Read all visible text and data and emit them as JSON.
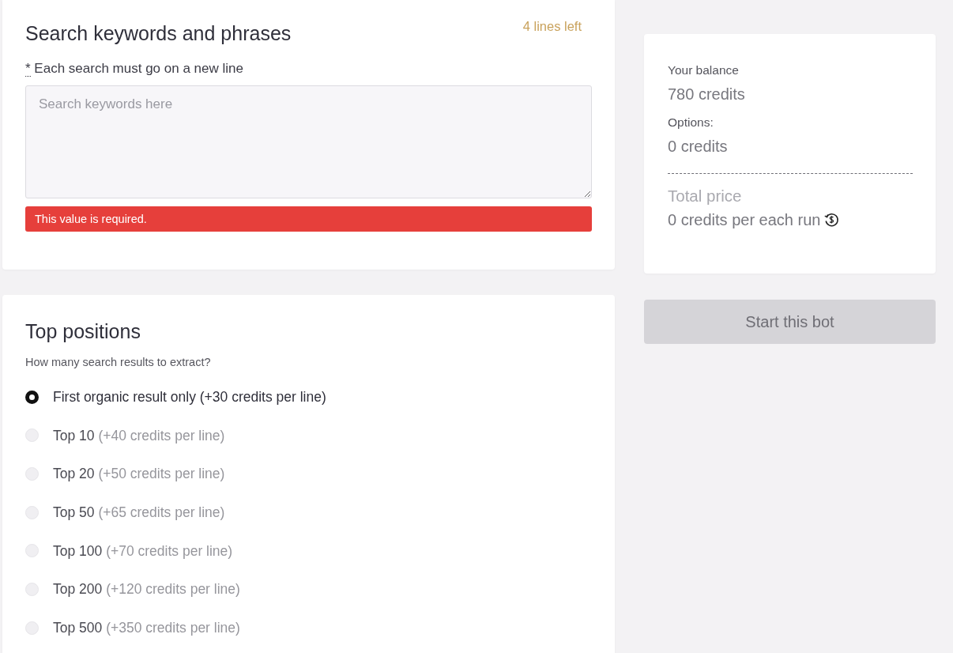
{
  "keywords_panel": {
    "title": "Search keywords and phrases",
    "lines_left": "4 lines left",
    "hint": {
      "required_mark": "*",
      "text": "Each search must go on a new line"
    },
    "textarea": {
      "placeholder": "Search keywords here"
    },
    "error": "This value is required."
  },
  "positions_panel": {
    "title": "Top positions",
    "question": "How many search results to extract?",
    "options": [
      {
        "label": "First organic result only",
        "price": "(+30 credits per line)",
        "selected": true
      },
      {
        "label": "Top 10",
        "price": "(+40 credits per line)",
        "selected": false
      },
      {
        "label": "Top 20",
        "price": "(+50 credits per line)",
        "selected": false
      },
      {
        "label": "Top 50",
        "price": "(+65 credits per line)",
        "selected": false
      },
      {
        "label": "Top 100",
        "price": "(+70 credits per line)",
        "selected": false
      },
      {
        "label": "Top 200",
        "price": "(+120 credits per line)",
        "selected": false
      },
      {
        "label": "Top 500",
        "price": "(+350 credits per line)",
        "selected": false
      }
    ]
  },
  "summary": {
    "balance_label": "Your balance",
    "balance": "780 credits",
    "options_label": "Options:",
    "options_value": "0 credits",
    "total_label": "Total price",
    "total_value": "0 credits per each run"
  },
  "start_button": {
    "label": "Start this bot",
    "disabled": true
  }
}
